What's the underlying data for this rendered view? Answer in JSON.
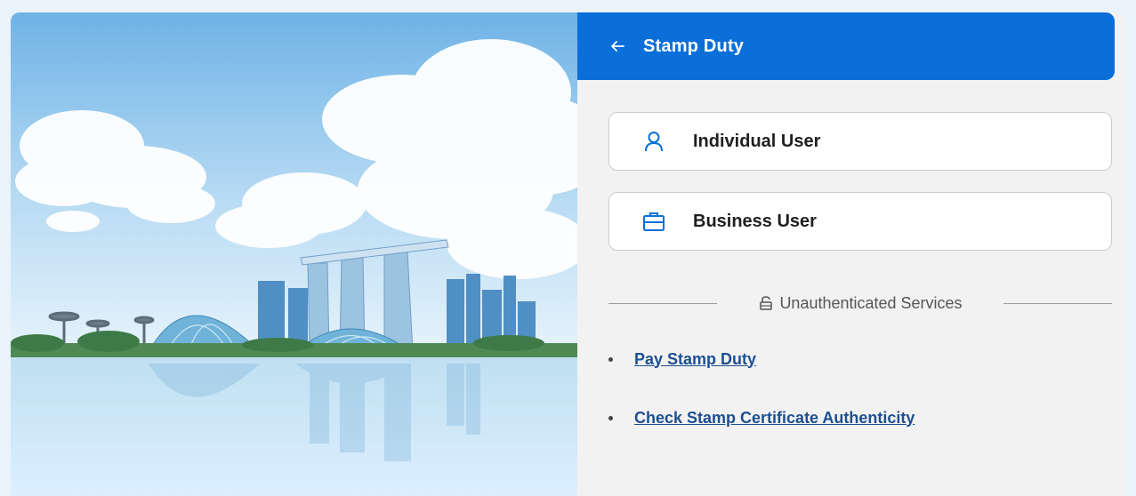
{
  "header": {
    "back_icon": "arrow-left-icon",
    "title": "Stamp Duty"
  },
  "user_options": [
    {
      "label": "Individual User",
      "icon": "person-icon"
    },
    {
      "label": "Business User",
      "icon": "briefcase-icon"
    }
  ],
  "unauthenticated": {
    "label": "Unauthenticated Services",
    "icon": "unlock-icon"
  },
  "links": [
    {
      "label": "Pay Stamp Duty"
    },
    {
      "label": "Check Stamp Certificate Authenticity"
    }
  ],
  "colors": {
    "header_bg": "#0a6fd8",
    "link": "#1d4f91",
    "icon_accent": "#0a6fd8",
    "panel_bg": "#f2f2f2"
  }
}
